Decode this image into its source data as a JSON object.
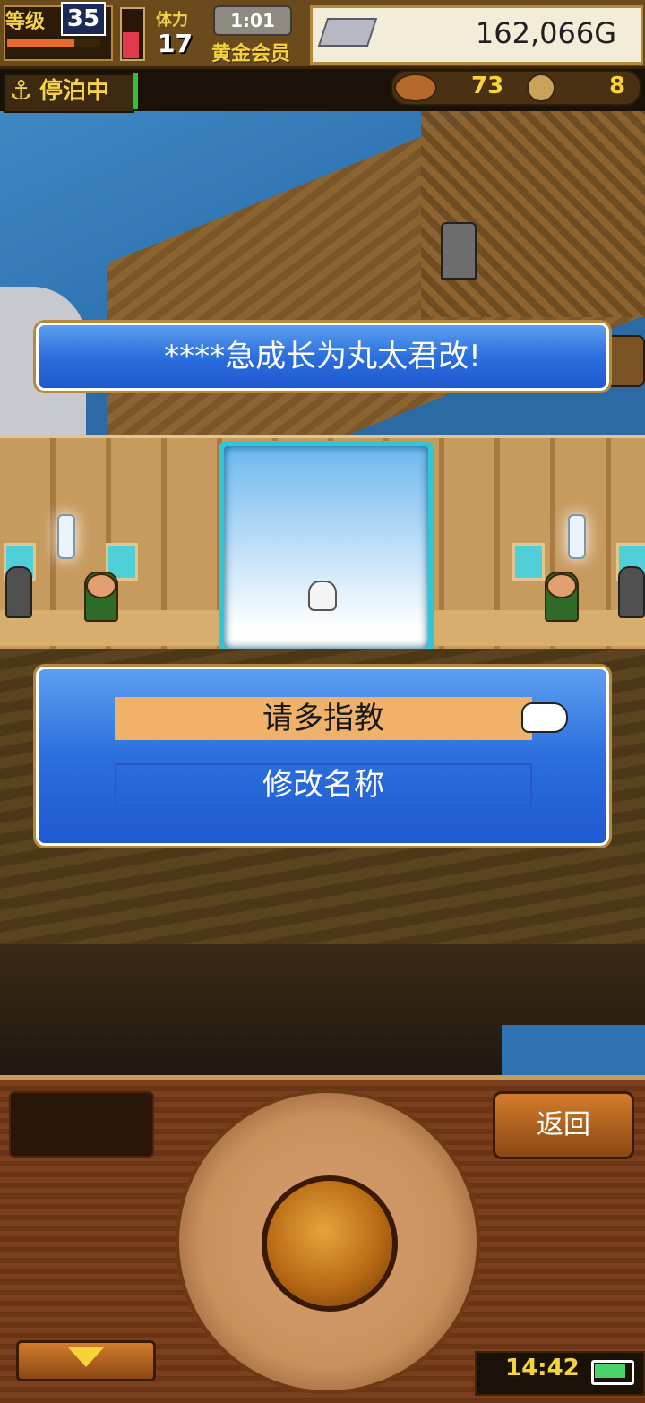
{
  "hud": {
    "level_label": "等级",
    "level_value": "35",
    "exp_fraction": 0.72,
    "hp_fraction": 0.55,
    "stamina_label": "体力",
    "stamina_value": "17",
    "timer": "1:01",
    "membership": "黄金会员",
    "gold": "162,066G"
  },
  "subhud": {
    "docked_label": "停泊中",
    "resource1_value": "73",
    "resource2_value": "8"
  },
  "message": {
    "text": "****急成长为丸太君改!"
  },
  "choices": [
    {
      "label": "请多指教",
      "selected": true
    },
    {
      "label": "修改名称",
      "selected": false
    }
  ],
  "controls": {
    "back_label": "返回"
  },
  "status": {
    "clock": "14:42"
  },
  "colors": {
    "dialog_blue": "#2c6fde",
    "selected_option": "#f0b26a",
    "portrait_border": "#2fc7d6",
    "gold_text": "#f6d33a"
  }
}
